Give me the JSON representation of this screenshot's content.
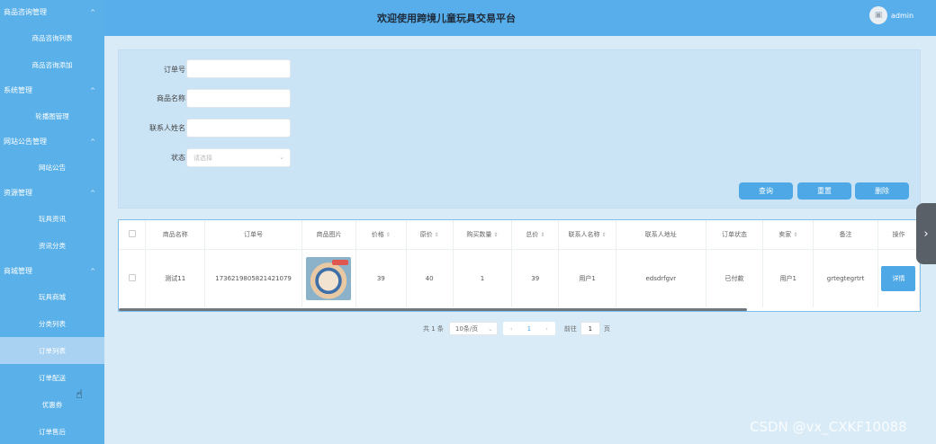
{
  "header": {
    "title": "欢迎使用跨境儿童玩具交易平台",
    "user": "admin"
  },
  "sidebar": [
    {
      "type": "group",
      "label": "商品咨询管理"
    },
    {
      "type": "item",
      "label": "商品咨询列表"
    },
    {
      "type": "item",
      "label": "商品咨询添加"
    },
    {
      "type": "group",
      "label": "系统管理"
    },
    {
      "type": "item",
      "label": "轮播图管理"
    },
    {
      "type": "group",
      "label": "网站公告管理"
    },
    {
      "type": "item",
      "label": "网站公告"
    },
    {
      "type": "group",
      "label": "资源管理"
    },
    {
      "type": "item",
      "label": "玩具资讯"
    },
    {
      "type": "item",
      "label": "资讯分类"
    },
    {
      "type": "group",
      "label": "商城管理"
    },
    {
      "type": "item",
      "label": "玩具商城"
    },
    {
      "type": "item",
      "label": "分类列表"
    },
    {
      "type": "item",
      "label": "订单列表",
      "active": true
    },
    {
      "type": "item",
      "label": "订单配送"
    },
    {
      "type": "item",
      "label": "优惠券"
    },
    {
      "type": "item",
      "label": "订单售后"
    }
  ],
  "search": {
    "order_no_label": "订单号",
    "product_name_label": "商品名称",
    "contact_name_label": "联系人姓名",
    "status_label": "状态",
    "status_placeholder": "请选择",
    "query_btn": "查询",
    "reset_btn": "重置",
    "delete_btn": "删除"
  },
  "table": {
    "headers": [
      "商品名称",
      "订单号",
      "商品图片",
      "价格",
      "原价",
      "购买数量",
      "总价",
      "联系人名称",
      "联系人地址",
      "订单状态",
      "卖家",
      "备注",
      "操作"
    ],
    "rows": [
      [
        "测试11",
        "1736219805821421079",
        "",
        "39",
        "40",
        "1",
        "39",
        "用户1",
        "edsdrfgvr",
        "已付款",
        "用户1",
        "grtegtegrtrt",
        "详情"
      ]
    ]
  },
  "pagination": {
    "total": "共 1 条",
    "page_size": "10条/页",
    "current_page": "1",
    "goto_prefix": "前往",
    "goto_value": "1",
    "goto_suffix": "页"
  },
  "watermark": "CSDN @vx_CXKF10088"
}
